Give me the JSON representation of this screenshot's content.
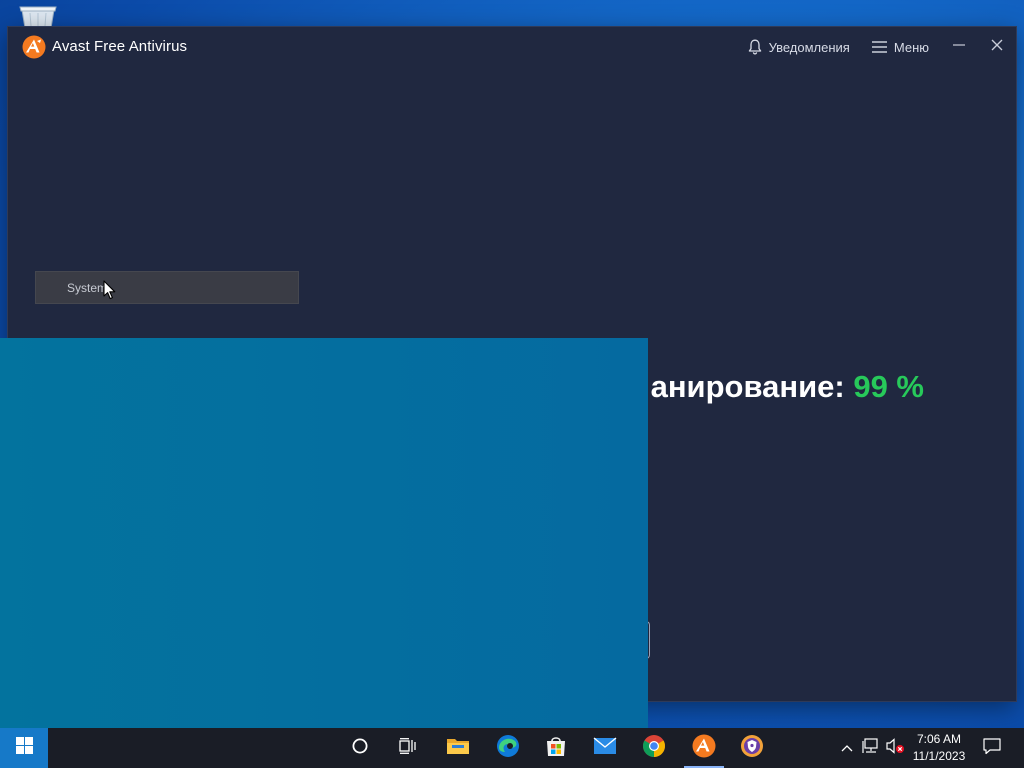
{
  "window": {
    "title": "Avast Free Antivirus",
    "notifications_label": "Уведомления",
    "menu_label": "Меню"
  },
  "tooltip": {
    "text": "System"
  },
  "scan": {
    "status_text": "анирование: ",
    "percent_text": "99 %",
    "percent_value": 99
  },
  "taskbar": {
    "icons": [
      "windows-start",
      "cortana-search",
      "task-view",
      "file-explorer",
      "edge",
      "microsoft-store",
      "mail",
      "chrome",
      "avast",
      "avast-secure-browser"
    ],
    "active_app": "avast"
  },
  "tray": {
    "icons": [
      "chevron-up",
      "network",
      "volume-muted",
      "action-center"
    ],
    "time": "7:06 AM",
    "date": "11/1/2023"
  },
  "colors": {
    "window_bg": "#202840",
    "accent_green": "#27c95a",
    "avast_orange": "#f47a20",
    "overlay": "#03739e",
    "taskbar": "#1a1d26"
  }
}
